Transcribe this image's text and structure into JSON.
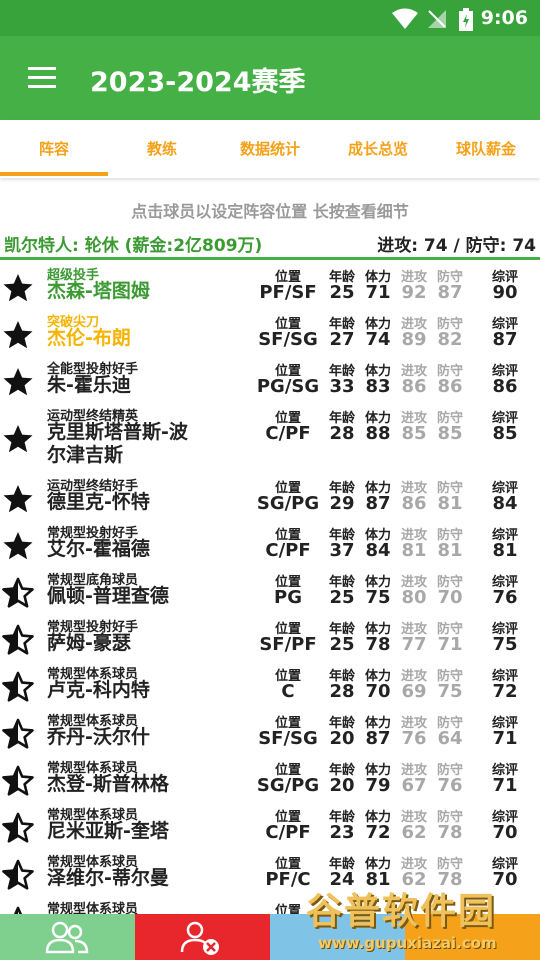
{
  "status_bar": {
    "time": "9:06"
  },
  "app_bar": {
    "title": "2023-2024赛季"
  },
  "tabs": [
    "阵容",
    "教练",
    "数据统计",
    "成长总览",
    "球队薪金"
  ],
  "hint": "点击球员以设定阵容位置 长按查看细节",
  "team": {
    "info": "凯尔特人: 轮休 (薪金:2亿809万)",
    "ratings": "进攻: 74  /  防守: 74"
  },
  "labels": {
    "pos": "位置",
    "age": "年龄",
    "stamina": "体力",
    "off": "进攻",
    "def": "防守",
    "ovr": "综评"
  },
  "players": [
    {
      "type": "超级投手",
      "name": "杰森-塔图姆",
      "pos": "PF/SF",
      "age": "25",
      "stamina": "71",
      "off": "92",
      "def": "87",
      "ovr": "90",
      "star": "full",
      "color": "#3c9a33"
    },
    {
      "type": "突破尖刀",
      "name": "杰伦-布朗",
      "pos": "SF/SG",
      "age": "27",
      "stamina": "74",
      "off": "89",
      "def": "82",
      "ovr": "87",
      "star": "full",
      "color": "#f5b400"
    },
    {
      "type": "全能型投射好手",
      "name": "朱-霍乐迪",
      "pos": "PG/SG",
      "age": "33",
      "stamina": "83",
      "off": "86",
      "def": "86",
      "ovr": "86",
      "star": "full",
      "color": "#222222"
    },
    {
      "type": "运动型终结精英",
      "name": "克里斯塔普斯-波尔津吉斯",
      "pos": "C/PF",
      "age": "28",
      "stamina": "88",
      "off": "85",
      "def": "85",
      "ovr": "85",
      "star": "full",
      "color": "#222222",
      "tall": true
    },
    {
      "type": "运动型终结好手",
      "name": "德里克-怀特",
      "pos": "SG/PG",
      "age": "29",
      "stamina": "87",
      "off": "86",
      "def": "81",
      "ovr": "84",
      "star": "full",
      "color": "#222222"
    },
    {
      "type": "常规型投射好手",
      "name": "艾尔-霍福德",
      "pos": "C/PF",
      "age": "37",
      "stamina": "84",
      "off": "81",
      "def": "81",
      "ovr": "81",
      "star": "full",
      "color": "#222222"
    },
    {
      "type": "常规型底角球员",
      "name": "佩顿-普理查德",
      "pos": "PG",
      "age": "25",
      "stamina": "75",
      "off": "80",
      "def": "70",
      "ovr": "76",
      "star": "half",
      "color": "#222222"
    },
    {
      "type": "常规型投射好手",
      "name": "萨姆-豪瑟",
      "pos": "SF/PF",
      "age": "25",
      "stamina": "78",
      "off": "77",
      "def": "71",
      "ovr": "75",
      "star": "half",
      "color": "#222222"
    },
    {
      "type": "常规型体系球员",
      "name": "卢克-科内特",
      "pos": "C",
      "age": "28",
      "stamina": "70",
      "off": "69",
      "def": "75",
      "ovr": "72",
      "star": "half",
      "color": "#222222"
    },
    {
      "type": "常规型体系球员",
      "name": "乔丹-沃尔什",
      "pos": "SF/SG",
      "age": "20",
      "stamina": "87",
      "off": "76",
      "def": "64",
      "ovr": "71",
      "star": "half",
      "color": "#222222"
    },
    {
      "type": "常规型体系球员",
      "name": "杰登-斯普林格",
      "pos": "SG/PG",
      "age": "20",
      "stamina": "79",
      "off": "67",
      "def": "76",
      "ovr": "71",
      "star": "half",
      "color": "#222222"
    },
    {
      "type": "常规型体系球员",
      "name": "尼米亚斯-奎塔",
      "pos": "C/PF",
      "age": "23",
      "stamina": "72",
      "off": "62",
      "def": "78",
      "ovr": "70",
      "star": "half",
      "color": "#222222"
    },
    {
      "type": "常规型体系球员",
      "name": "泽维尔-蒂尔曼",
      "pos": "PF/C",
      "age": "24",
      "stamina": "81",
      "off": "62",
      "def": "78",
      "ovr": "70",
      "star": "half",
      "color": "#222222"
    },
    {
      "type": "常规型体系球员",
      "name": "",
      "pos": "位置",
      "age": "",
      "stamina": "",
      "off": "",
      "def": "",
      "ovr": "",
      "star": "half",
      "color": "#222222"
    }
  ],
  "bottom_bar": {
    "colors": [
      "#7fcf8e",
      "#e8272d",
      "#7fc4e6",
      "#f5a21a"
    ]
  },
  "watermark": {
    "line1": "谷普软件园",
    "line2": "www.gupuxiazai.com"
  },
  "colors": {
    "primary": "#45b046",
    "accent": "#f5a21a"
  }
}
